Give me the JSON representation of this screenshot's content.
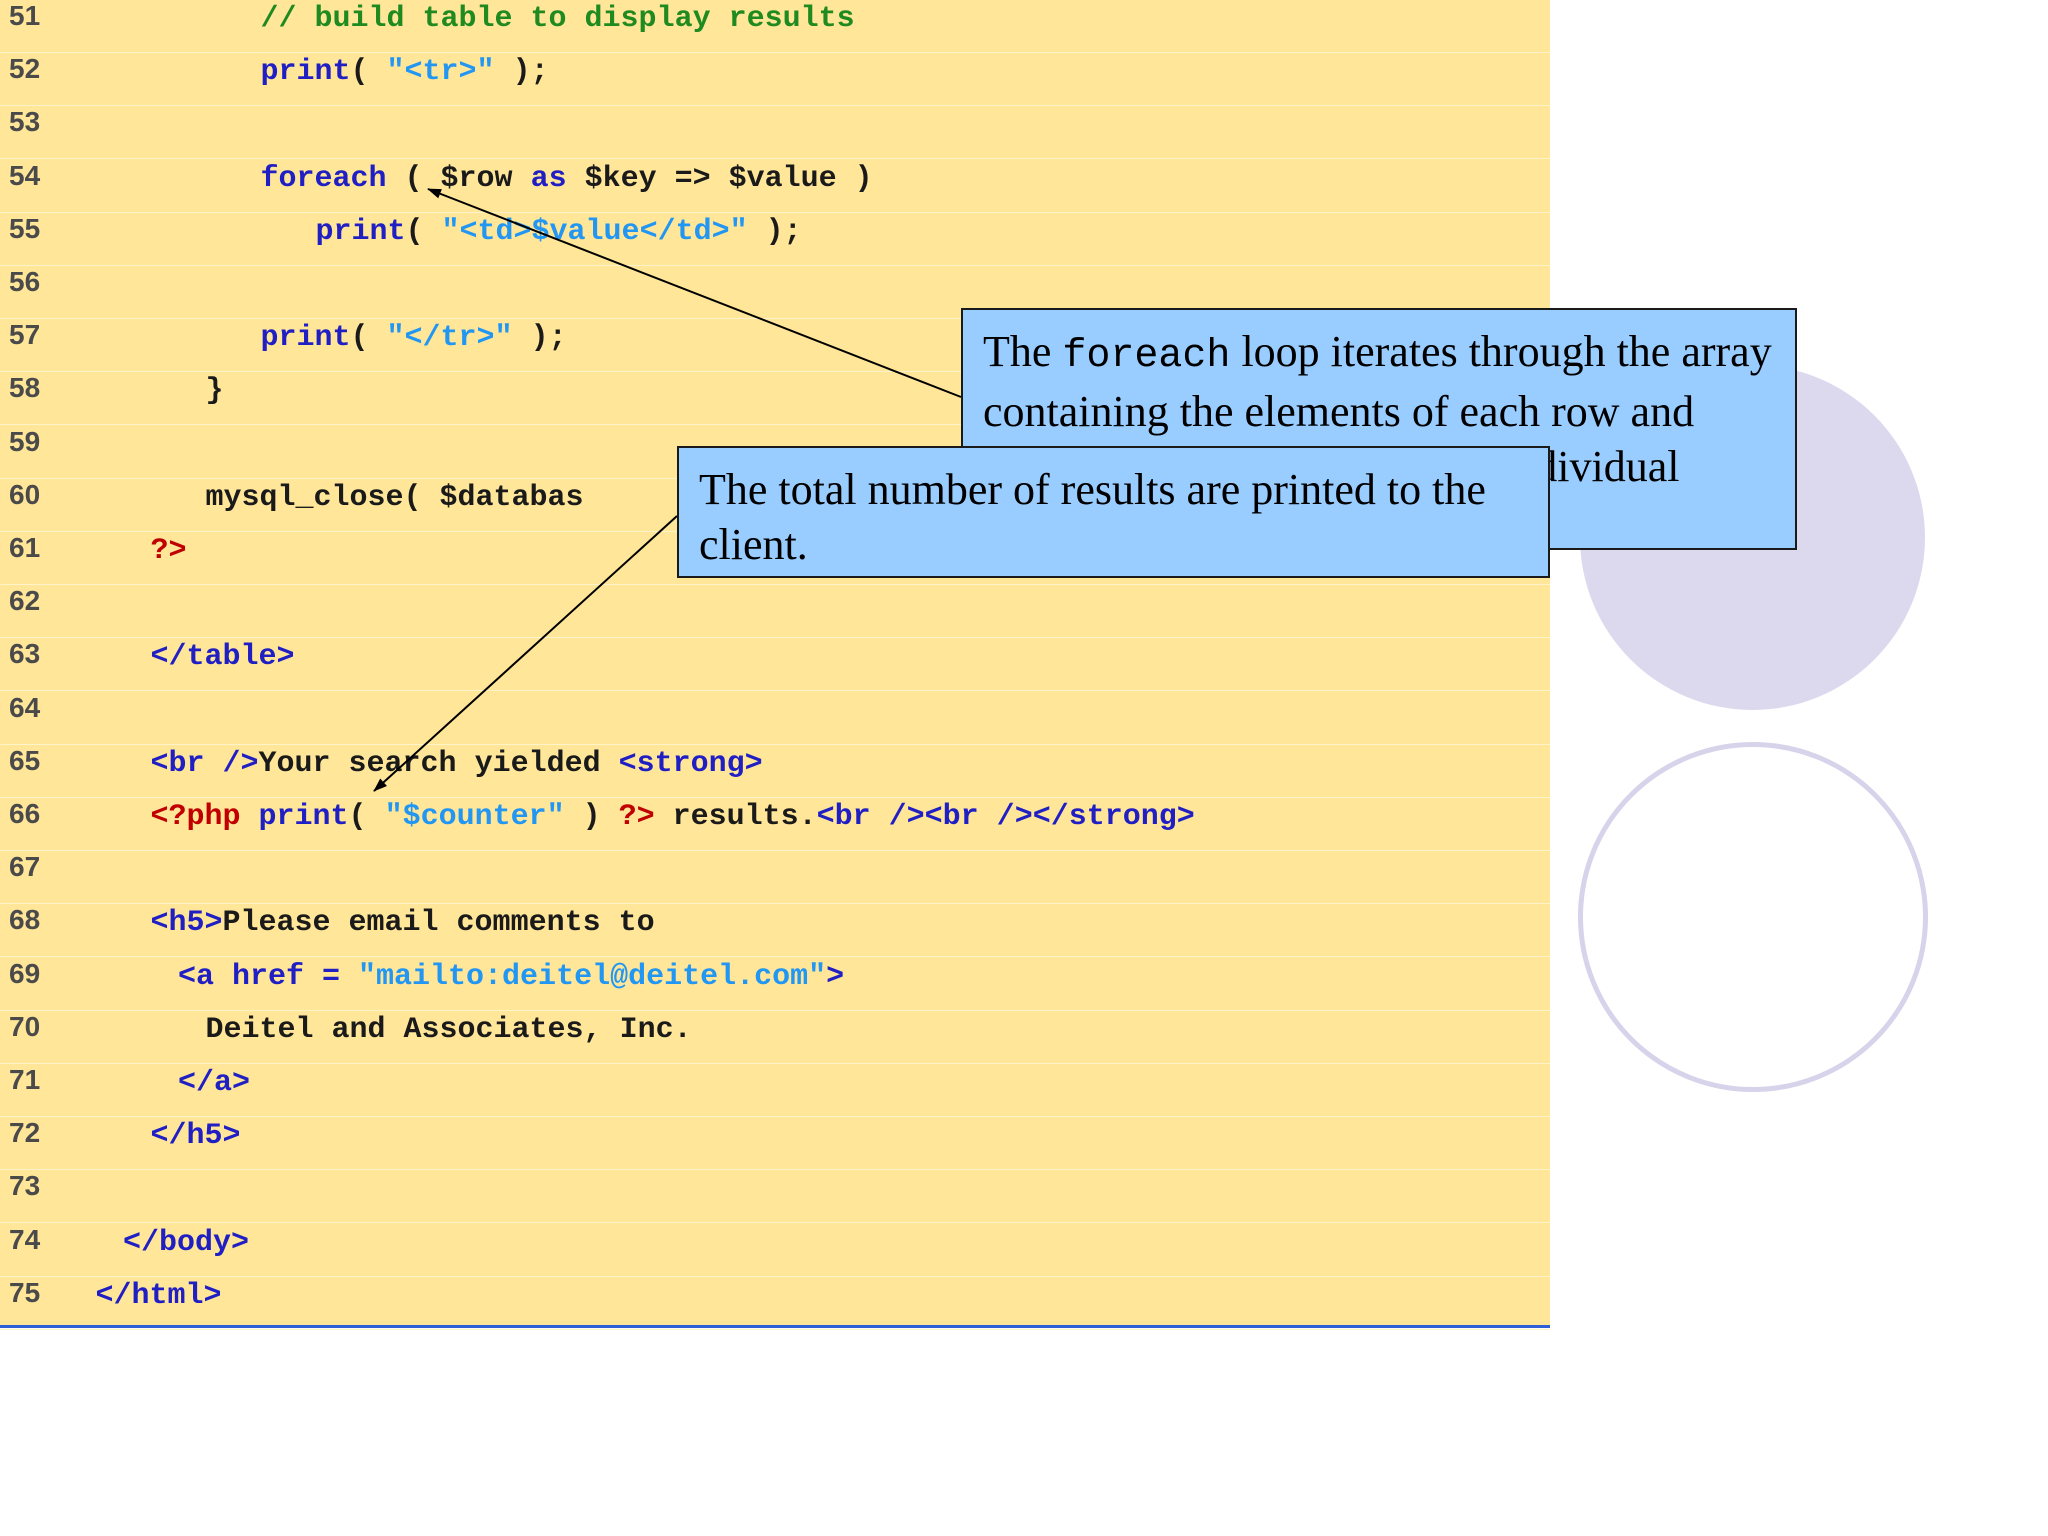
{
  "code": {
    "lines": [
      {
        "num": "51",
        "indent": 7,
        "tokens": [
          {
            "t": "// build table to display results",
            "c": "comment"
          }
        ]
      },
      {
        "num": "52",
        "indent": 7,
        "tokens": [
          {
            "t": "print",
            "c": "kw"
          },
          {
            "t": "( ",
            "c": "plain"
          },
          {
            "t": "\"<tr>\"",
            "c": "str"
          },
          {
            "t": " );",
            "c": "plain"
          }
        ]
      },
      {
        "num": "53",
        "indent": 0,
        "tokens": []
      },
      {
        "num": "54",
        "indent": 7,
        "tokens": [
          {
            "t": "foreach",
            "c": "kw"
          },
          {
            "t": " ( $row ",
            "c": "plain"
          },
          {
            "t": "as",
            "c": "kw"
          },
          {
            "t": " $key => $value )",
            "c": "plain"
          }
        ]
      },
      {
        "num": "55",
        "indent": 9,
        "tokens": [
          {
            "t": "print",
            "c": "kw"
          },
          {
            "t": "( ",
            "c": "plain"
          },
          {
            "t": "\"<td>$value</td>\"",
            "c": "str"
          },
          {
            "t": " );",
            "c": "plain"
          }
        ]
      },
      {
        "num": "56",
        "indent": 0,
        "tokens": []
      },
      {
        "num": "57",
        "indent": 7,
        "tokens": [
          {
            "t": "print",
            "c": "kw"
          },
          {
            "t": "( ",
            "c": "plain"
          },
          {
            "t": "\"</tr>\"",
            "c": "str"
          },
          {
            "t": " );",
            "c": "plain"
          }
        ]
      },
      {
        "num": "58",
        "indent": 5,
        "tokens": [
          {
            "t": "}",
            "c": "plain"
          }
        ]
      },
      {
        "num": "59",
        "indent": 0,
        "tokens": []
      },
      {
        "num": "60",
        "indent": 5,
        "tokens": [
          {
            "t": "mysql_close( $databas",
            "c": "plain"
          }
        ]
      },
      {
        "num": "61",
        "indent": 3,
        "tokens": [
          {
            "t": "?>",
            "c": "php"
          }
        ]
      },
      {
        "num": "62",
        "indent": 0,
        "tokens": []
      },
      {
        "num": "63",
        "indent": 3,
        "tokens": [
          {
            "t": "</table>",
            "c": "tag"
          }
        ]
      },
      {
        "num": "64",
        "indent": 0,
        "tokens": []
      },
      {
        "num": "65",
        "indent": 3,
        "tokens": [
          {
            "t": "<br />",
            "c": "tag"
          },
          {
            "t": "Your search yielded ",
            "c": "plain"
          },
          {
            "t": "<strong>",
            "c": "tag"
          }
        ]
      },
      {
        "num": "66",
        "indent": 3,
        "tokens": [
          {
            "t": "<?php",
            "c": "php"
          },
          {
            "t": " ",
            "c": "plain"
          },
          {
            "t": "print",
            "c": "kw"
          },
          {
            "t": "( ",
            "c": "plain"
          },
          {
            "t": "\"$counter\"",
            "c": "str"
          },
          {
            "t": " ) ",
            "c": "plain"
          },
          {
            "t": "?>",
            "c": "php"
          },
          {
            "t": " results.",
            "c": "plain"
          },
          {
            "t": "<br /><br /></strong>",
            "c": "tag"
          }
        ]
      },
      {
        "num": "67",
        "indent": 0,
        "tokens": []
      },
      {
        "num": "68",
        "indent": 3,
        "tokens": [
          {
            "t": "<h5>",
            "c": "tag"
          },
          {
            "t": "Please email comments to",
            "c": "plain"
          }
        ]
      },
      {
        "num": "69",
        "indent": 4,
        "tokens": [
          {
            "t": "<a href = ",
            "c": "tag"
          },
          {
            "t": "\"mailto:deitel@deitel.com\"",
            "c": "str"
          },
          {
            "t": ">",
            "c": "tag"
          }
        ]
      },
      {
        "num": "70",
        "indent": 5,
        "tokens": [
          {
            "t": "Deitel and Associates, Inc.",
            "c": "plain"
          }
        ]
      },
      {
        "num": "71",
        "indent": 4,
        "tokens": [
          {
            "t": "</a>",
            "c": "tag"
          }
        ]
      },
      {
        "num": "72",
        "indent": 3,
        "tokens": [
          {
            "t": "</h5>",
            "c": "tag"
          }
        ]
      },
      {
        "num": "73",
        "indent": 0,
        "tokens": []
      },
      {
        "num": "74",
        "indent": 2,
        "tokens": [
          {
            "t": "</body>",
            "c": "tag"
          }
        ]
      },
      {
        "num": "75",
        "indent": 1,
        "tokens": [
          {
            "t": "</html>",
            "c": "tag"
          }
        ]
      }
    ]
  },
  "callouts": {
    "foreach": {
      "text_before": "The ",
      "code_word": "foreach",
      "text_after": " loop iterates through the array containing the elements of each row and prints out each element in an individual table cell."
    },
    "results": {
      "text": "The total number of results are printed to the client."
    }
  },
  "colors": {
    "code_background": "#ffe699",
    "callout_background": "#99ccff",
    "comment": "#1f8a1f",
    "keyword": "#1f1fc4",
    "string": "#2196f3",
    "php_delimiter": "#c00000",
    "bottom_rule": "#2e5fd6"
  }
}
